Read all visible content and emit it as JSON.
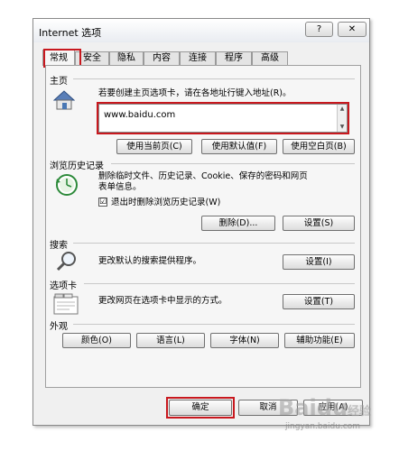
{
  "window": {
    "title": "Internet 选项",
    "help_label": "?",
    "close_label": "✕"
  },
  "tabs": [
    {
      "label": "常规"
    },
    {
      "label": "安全"
    },
    {
      "label": "隐私"
    },
    {
      "label": "内容"
    },
    {
      "label": "连接"
    },
    {
      "label": "程序"
    },
    {
      "label": "高级"
    }
  ],
  "homepage": {
    "heading": "主页",
    "description": "若要创建主页选项卡，请在各地址行键入地址(R)。",
    "address": "www.baidu.com",
    "btn_current": "使用当前页(C)",
    "btn_default": "使用默认值(F)",
    "btn_blank": "使用空白页(B)"
  },
  "history": {
    "heading": "浏览历史记录",
    "description_line1": "删除临时文件、历史记录、Cookie、保存的密码和网页",
    "description_line2": "表单信息。",
    "checkbox_label": "退出时删除浏览历史记录(W)",
    "checkbox_checked": "☑",
    "btn_delete": "删除(D)...",
    "btn_settings": "设置(S)"
  },
  "search": {
    "heading": "搜索",
    "description": "更改默认的搜索提供程序。",
    "btn_settings": "设置(I)"
  },
  "tabs_section": {
    "heading": "选项卡",
    "description": "更改网页在选项卡中显示的方式。",
    "btn_settings": "设置(T)"
  },
  "appearance": {
    "heading": "外观",
    "btn_colors": "颜色(O)",
    "btn_languages": "语言(L)",
    "btn_fonts": "字体(N)",
    "btn_accessibility": "辅助功能(E)"
  },
  "footer": {
    "btn_ok": "确定",
    "btn_cancel": "取消",
    "btn_apply": "应用(A)"
  },
  "watermark": {
    "brand": "Baidu",
    "cn": "经验",
    "url": "jingyan.baidu.com"
  },
  "colors": {
    "highlight_red": "#c8181e"
  }
}
